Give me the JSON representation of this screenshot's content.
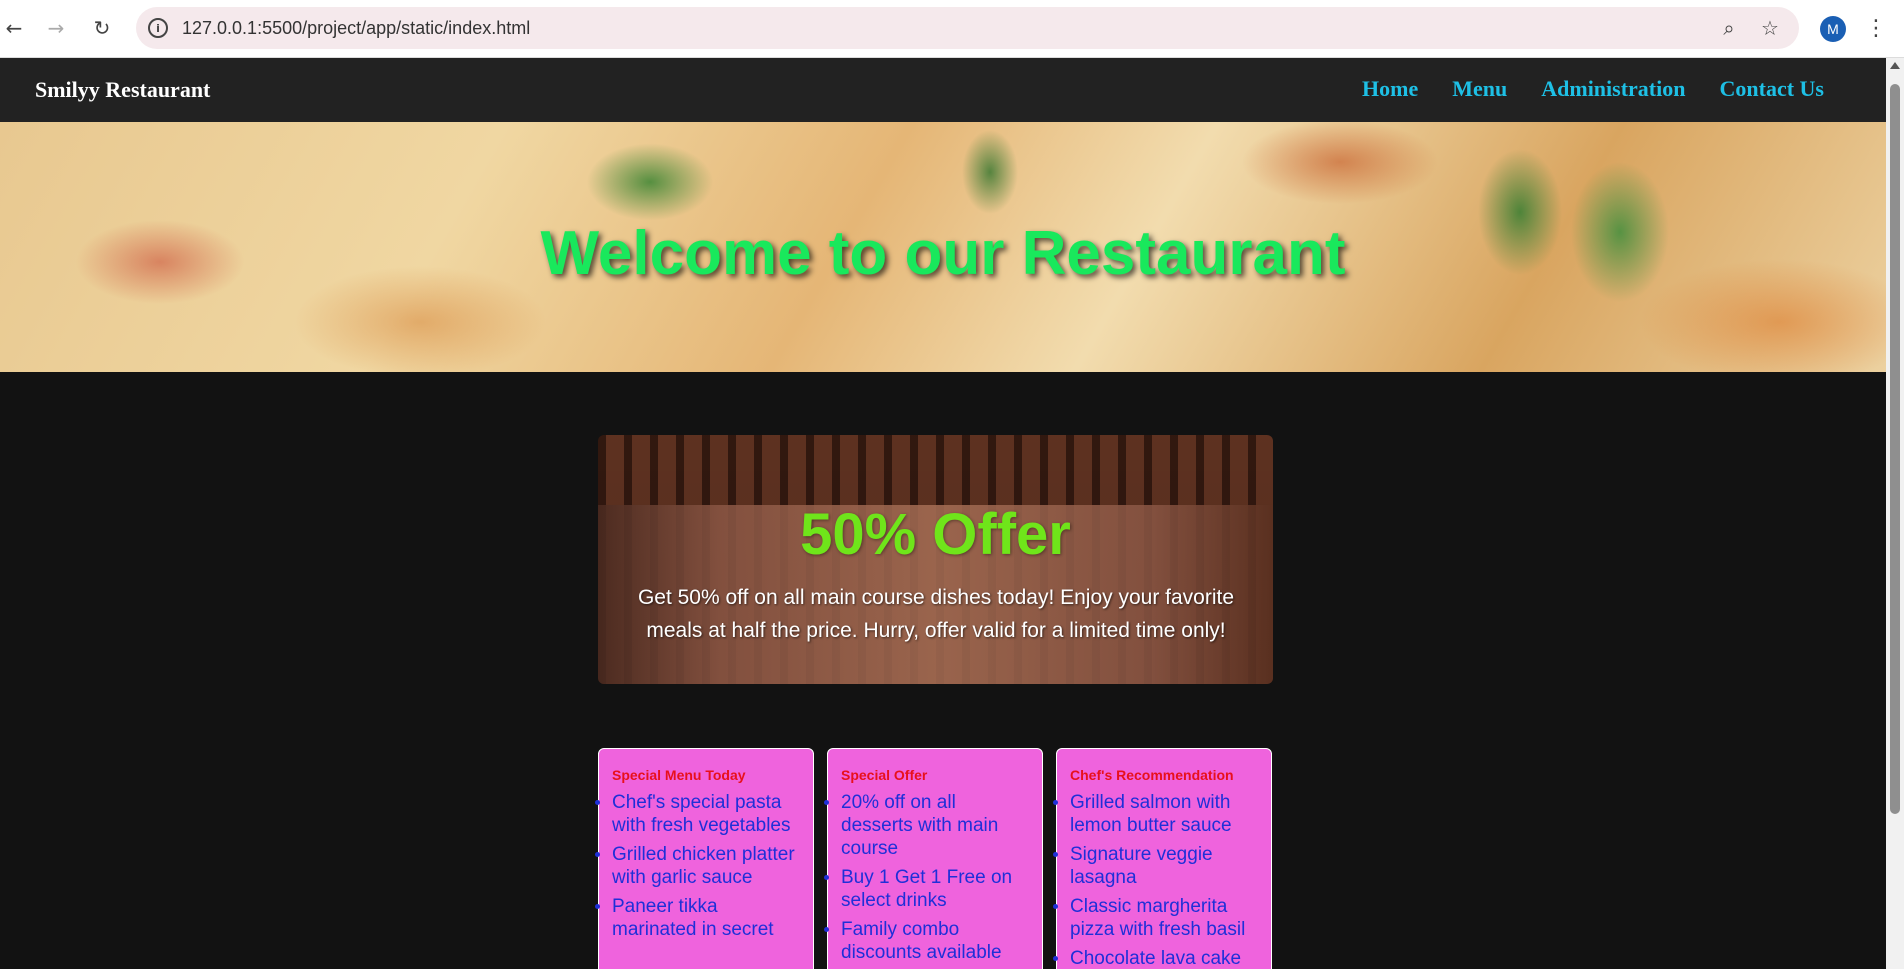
{
  "browser": {
    "url": "127.0.0.1:5500/project/app/static/index.html",
    "profile_initial": "M"
  },
  "site": {
    "brand": "Smilyy Restaurant",
    "nav": [
      "Home",
      "Menu",
      "Administration",
      "Contact Us"
    ]
  },
  "hero": {
    "title": "Welcome to our Restaurant"
  },
  "offer": {
    "title": "50% Offer",
    "text": "Get 50% off on all main course dishes today! Enjoy your favorite meals at half the price. Hurry, offer valid for a limited time only!"
  },
  "cards": [
    {
      "title": "Special Menu Today",
      "items": [
        "Chef's special pasta with fresh vegetables",
        "Grilled chicken platter with garlic sauce",
        "Paneer tikka marinated in secret"
      ]
    },
    {
      "title": "Special Offer",
      "items": [
        "20% off on all desserts with main course",
        "Buy 1 Get 1 Free on select drinks",
        "Family combo discounts available"
      ]
    },
    {
      "title": "Chef's Recommendation",
      "items": [
        "Grilled salmon with lemon butter sauce",
        "Signature veggie lasagna",
        "Classic margherita pizza with fresh basil",
        "Chocolate lava cake"
      ]
    }
  ],
  "colors": {
    "navbar_bg": "#222222",
    "nav_link": "#1ec0e6",
    "hero_title": "#19e85c",
    "offer_title": "#6fe51a",
    "card_bg": "#ef63dd",
    "card_title": "#e8101c",
    "card_item": "#1f2fd8"
  }
}
